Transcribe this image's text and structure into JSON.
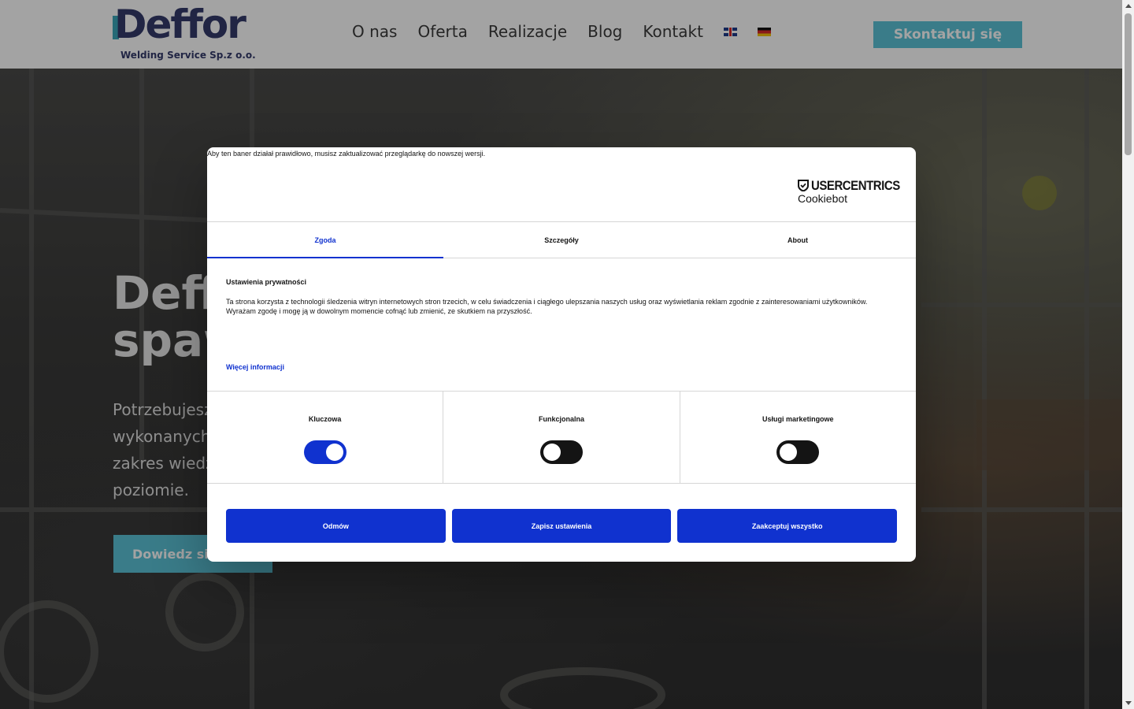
{
  "site": {
    "logo_text": "Deffor",
    "logo_subtitle": "Welding Service Sp.z o.o.",
    "nav": [
      "O nas",
      "Oferta",
      "Realizacje",
      "Blog",
      "Kontakt"
    ],
    "cta": "Skontaktuj się"
  },
  "hero": {
    "title_line1": "Deff",
    "title_line2": "spaw",
    "text_line1": "Potrzebujesz",
    "text_line2": "wykonanych",
    "text_line3": "zakres wiedz",
    "text_line4": "poziomie.",
    "cta": "Dowiedz się"
  },
  "cookie": {
    "browser_warning": "Aby ten baner działał prawidłowo, musisz zaktualizować przeglądarkę do nowszej wersji.",
    "brand": "USERCENTRICS",
    "product": "Cookiebot",
    "tabs": [
      "Zgoda",
      "Szczegóły",
      "About"
    ],
    "heading": "Ustawienia prywatności",
    "text_line1": "Ta strona korzysta z technologii śledzenia witryn internetowych stron trzecich, w celu świadczenia i ciągłego ulepszania naszych usług oraz wyświetlania reklam zgodnie z zainteresowaniami użytkowników.",
    "text_line2": "Wyrażam zgodę i mogę ją w dowolnym momencie cofnąć lub zmienić, ze skutkiem na przyszłość.",
    "more_info": "Więcej informacji",
    "categories": [
      {
        "label": "Kluczowa",
        "enabled": true
      },
      {
        "label": "Funkcjonalna",
        "enabled": false
      },
      {
        "label": "Usługi marketingowe",
        "enabled": false
      }
    ],
    "buttons": {
      "deny": "Odmów",
      "save": "Zapisz ustawienia",
      "accept_all": "Zaakceptuj wszystko"
    },
    "accent_color": "#1032cf"
  },
  "colors": {
    "brand_navy": "#343b6b",
    "brand_teal": "#5cc3d6"
  }
}
